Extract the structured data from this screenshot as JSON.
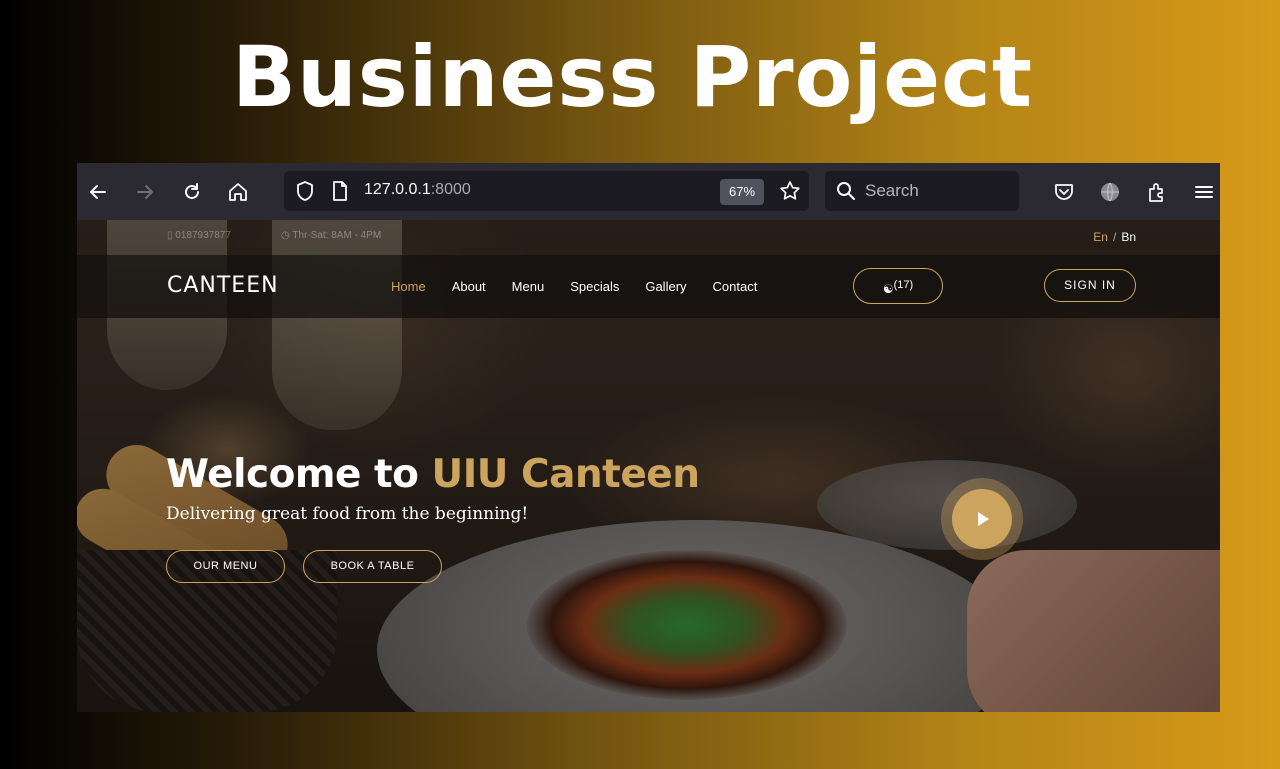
{
  "banner": {
    "title": "Business Project"
  },
  "browser": {
    "url_host": "127.0.0.1",
    "url_port": ":8000",
    "zoom": "67%",
    "search_placeholder": "Search",
    "icons": [
      "back-arrow-icon",
      "forward-arrow-icon",
      "reload-icon",
      "home-icon",
      "shield-icon",
      "page-icon",
      "star-icon",
      "search-icon",
      "pocket-icon",
      "globe-icon",
      "extensions-icon",
      "menu-icon"
    ]
  },
  "site": {
    "topbar": {
      "phone": "0187937877",
      "hours": "Thr-Sat: 8AM - 4PM",
      "lang_en": "En",
      "lang_sep": "/",
      "lang_bn": "Bn"
    },
    "nav": {
      "logo": "CANTEEN",
      "links": [
        "Home",
        "About",
        "Menu",
        "Specials",
        "Gallery",
        "Contact"
      ],
      "active_link": "Home",
      "cart_count": "(17)",
      "signin": "SIGN IN"
    },
    "hero": {
      "title_prefix": "Welcome to ",
      "title_accent": "UIU Canteen",
      "subtitle": "Delivering great food from the beginning!",
      "btn_menu": "OUR MENU",
      "btn_book": "BOOK A TABLE"
    },
    "colors": {
      "accent": "#cda45e",
      "toolbar": "#2b2a33",
      "urlbar": "#1c1b22"
    }
  }
}
